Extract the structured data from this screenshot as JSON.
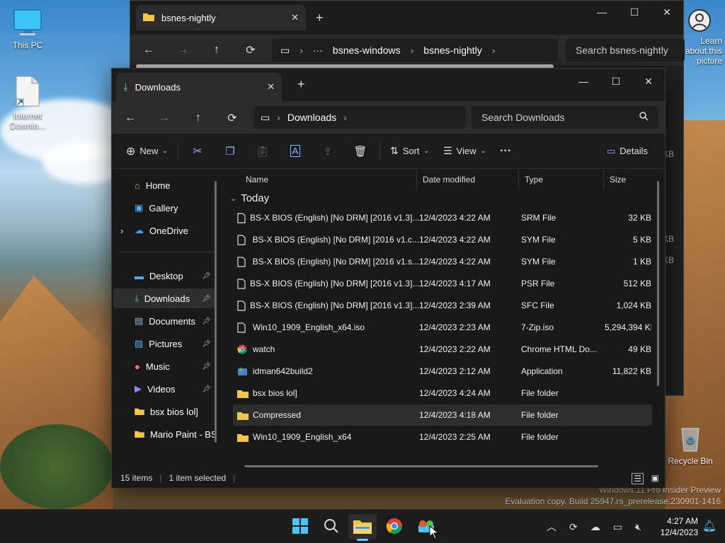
{
  "desktop": {
    "icons": [
      {
        "label": "This PC"
      },
      {
        "label": "Internet Downlo..."
      },
      {
        "label": "Recycle Bin"
      },
      {
        "label": "Learn about this picture"
      }
    ],
    "watermark_line1": "Windows 11 Pro Insider Preview",
    "watermark_line2": "Evaluation copy. Build 25947.rs_prerelease.230901-1416"
  },
  "back_window": {
    "tab_title": "bsnes-nightly",
    "breadcrumb": [
      "bsnes-windows",
      "bsnes-nightly"
    ],
    "search_placeholder": "Search bsnes-nightly",
    "partial_sizes": [
      "KB",
      "KB",
      "KB"
    ]
  },
  "front_window": {
    "tab_title": "Downloads",
    "breadcrumb": [
      "Downloads"
    ],
    "search_placeholder": "Search Downloads",
    "toolbar": {
      "new_label": "New",
      "sort_label": "Sort",
      "view_label": "View",
      "details_label": "Details"
    },
    "nav": [
      {
        "label": "Home"
      },
      {
        "label": "Gallery"
      },
      {
        "label": "OneDrive"
      },
      {
        "label": "Desktop"
      },
      {
        "label": "Downloads"
      },
      {
        "label": "Documents"
      },
      {
        "label": "Pictures"
      },
      {
        "label": "Music"
      },
      {
        "label": "Videos"
      },
      {
        "label": "bsx bios lol]"
      },
      {
        "label": "Mario Paint - BS"
      }
    ],
    "columns": {
      "name": "Name",
      "date": "Date modified",
      "type": "Type",
      "size": "Size"
    },
    "group": "Today",
    "files": [
      {
        "name": "BS-X BIOS (English) [No DRM] [2016 v1.3]...",
        "date": "12/4/2023 4:22 AM",
        "type": "SRM File",
        "size": "32 KB",
        "icon": "file-icon"
      },
      {
        "name": "BS-X BIOS (English) [No DRM] [2016 v1.c...",
        "date": "12/4/2023 4:22 AM",
        "type": "SYM File",
        "size": "5 KB",
        "icon": "file-icon"
      },
      {
        "name": "BS-X BIOS (English) [No DRM] [2016 v1.s...",
        "date": "12/4/2023 4:22 AM",
        "type": "SYM File",
        "size": "1 KB",
        "icon": "file-icon"
      },
      {
        "name": "BS-X BIOS (English) [No DRM] [2016 v1.3]...",
        "date": "12/4/2023 4:17 AM",
        "type": "PSR File",
        "size": "512 KB",
        "icon": "file-icon"
      },
      {
        "name": "BS-X BIOS (English) [No DRM] [2016 v1.3]...",
        "date": "12/4/2023 2:39 AM",
        "type": "SFC File",
        "size": "1,024 KB",
        "icon": "file-icon"
      },
      {
        "name": "Win10_1909_English_x64.iso",
        "date": "12/4/2023 2:23 AM",
        "type": "7-Zip.iso",
        "size": "5,294,394 KB",
        "icon": "file-icon"
      },
      {
        "name": "watch",
        "date": "12/4/2023 2:22 AM",
        "type": "Chrome HTML Do...",
        "size": "49 KB",
        "icon": "chrome-icon"
      },
      {
        "name": "idman642build2",
        "date": "12/4/2023 2:12 AM",
        "type": "Application",
        "size": "11,822 KB",
        "icon": "app-icon"
      },
      {
        "name": "bsx bios lol]",
        "date": "12/4/2023 4:24 AM",
        "type": "File folder",
        "size": "",
        "icon": "folder-icon"
      },
      {
        "name": "Compressed",
        "date": "12/4/2023 4:18 AM",
        "type": "File folder",
        "size": "",
        "icon": "folder-icon"
      },
      {
        "name": "Win10_1909_English_x64",
        "date": "12/4/2023 2:25 AM",
        "type": "File folder",
        "size": "",
        "icon": "folder-icon"
      }
    ],
    "status": {
      "items": "15 items",
      "selected": "1 item selected"
    }
  },
  "taskbar": {
    "time": "4:27 AM",
    "date": "12/4/2023"
  },
  "colors": {
    "accent": "#60cdff",
    "folder": "#f3c64a"
  }
}
